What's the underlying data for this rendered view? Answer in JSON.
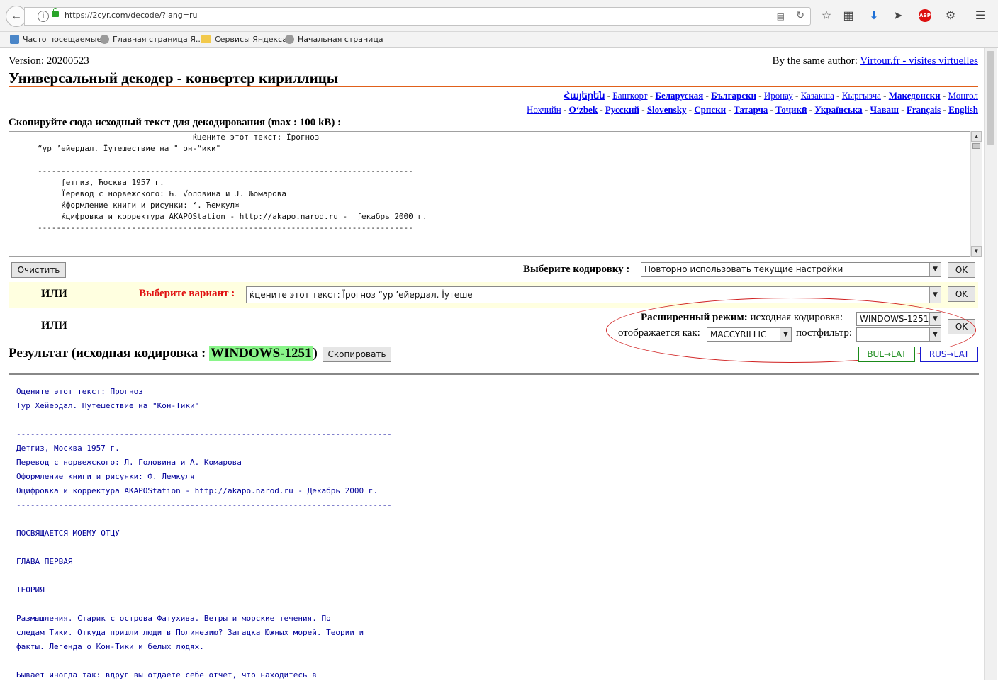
{
  "browser": {
    "url": "https://2cyr.com/decode/?lang=ru",
    "bookmarks": [
      "Часто посещаемые",
      "Главная страница Я...",
      "Сервисы Яндекса",
      "Начальная страница"
    ],
    "abp_label": "ABP"
  },
  "header": {
    "version": "Version: 20200523",
    "author_prefix": "By the same author:",
    "author_link": "Virtour.fr - visites virtuelles",
    "title": "Универсальный декодер - конвертер кириллицы"
  },
  "languages": {
    "row1": [
      {
        "label": "Հայերեն",
        "bold": true
      },
      {
        "label": "Башҡорт",
        "bold": false
      },
      {
        "label": "Беларуская",
        "bold": true
      },
      {
        "label": "Български",
        "bold": true
      },
      {
        "label": "Иронау",
        "bold": false
      },
      {
        "label": "Казакша",
        "bold": false
      },
      {
        "label": "Кыргызча",
        "bold": false
      },
      {
        "label": "Македонски",
        "bold": true
      },
      {
        "label": "Монгол",
        "bold": false
      }
    ],
    "row2": [
      {
        "label": "Нохчийн",
        "bold": false
      },
      {
        "label": "O‘zbek",
        "bold": true
      },
      {
        "label": "Русский",
        "bold": true
      },
      {
        "label": "Slovensky",
        "bold": true
      },
      {
        "label": "Српски",
        "bold": true
      },
      {
        "label": "Татарча",
        "bold": true
      },
      {
        "label": "Тоҷикӣ",
        "bold": true
      },
      {
        "label": "Українська",
        "bold": true
      },
      {
        "label": "Чаваш",
        "bold": true
      },
      {
        "label": "Français",
        "bold": true
      },
      {
        "label": "English",
        "bold": true
      }
    ],
    "separator": "-"
  },
  "input": {
    "label": "Скопируйте сюда исходный текст для декодирования (max : 100 kB) :",
    "text": "                                 ќцените этот текст: Їрогноз\n“ур ’ейердал. Їутешествие на \" он-“ики\"\n\n--------------------------------------------------------------------------------\n     ƒетгиз, Ћосква 1957 г.\n     Їеревод с норвежского: Ћ. √оловина и Ј. Љомарова\n     ќформление книги и рисунки: ‘. Ћемкул¤\n     ќцифровка и корректура AKAPOStation - http://akapo.narod.ru -  ƒекабрь 2000 г.\n--------------------------------------------------------------------------------\n\n\n                     ЇќЅ¬яўј≈“—я ЋќЁћ” ќ“÷”"
  },
  "controls": {
    "clear_button": "Очистить",
    "encoding_label": "Выберите кодировку :",
    "encoding_value": "Повторно использовать текущие настройки",
    "ok": "OK",
    "or_label": "ИЛИ",
    "variant_label": "Выберите вариант :",
    "variant_value": "ќцените этот текст: Їрогноз “ур ’ейердал. Їутеше",
    "advanced_bold": "Расширенный режим:",
    "source_encoding_label": "исходная кодировка:",
    "source_encoding_value": "WINDOWS-1251",
    "display_as_label": "отображается как:",
    "display_as_value": "MACCYRILLIC",
    "postfilter_label": "постфильтр:",
    "postfilter_value": ""
  },
  "result": {
    "label_prefix": "Результат (исходная кодировка :",
    "encoding": "WINDOWS-1251",
    "label_suffix": ")",
    "copy_button": "Скопировать",
    "bul_lat": "BUL→LAT",
    "rus_lat": "RUS→LAT",
    "lines": [
      "Оцените этот текст: Прогноз",
      "Тур Хейердал. Путешествие на \"Кон-Тики\"",
      "",
      "--------------------------------------------------------------------------------",
      "Детгиз, Москва 1957 г.",
      "Перевод с норвежского: Л. Головина и А. Комарова",
      "Оформление книги и рисунки: Ф. Лемкуля",
      "Оцифровка и корректура AKAPOStation - http://akapo.narod.ru - Декабрь 2000 г.",
      "--------------------------------------------------------------------------------",
      "",
      "ПОСВЯЩАЕТСЯ МОЕМУ ОТЦУ",
      "",
      "ГЛАВА ПЕРВАЯ",
      "",
      "ТЕОРИЯ",
      "",
      "Размышления. Старик с острова Фатухива. Ветры и морские течения. По",
      "следам Тики. Откуда пришли люди в Полинезию? Загадка Южных морей. Теории и",
      "факты. Легенда о Кон-Тики и белых людях.",
      "",
      "Бывает иногда так: вдруг вы отдаете себе отчет, что находитесь в"
    ]
  },
  "colors": {
    "accent_red": "#e01010",
    "result_highlight": "#8af58a",
    "result_text": "#000099",
    "variant_bg": "#ffffe0"
  }
}
